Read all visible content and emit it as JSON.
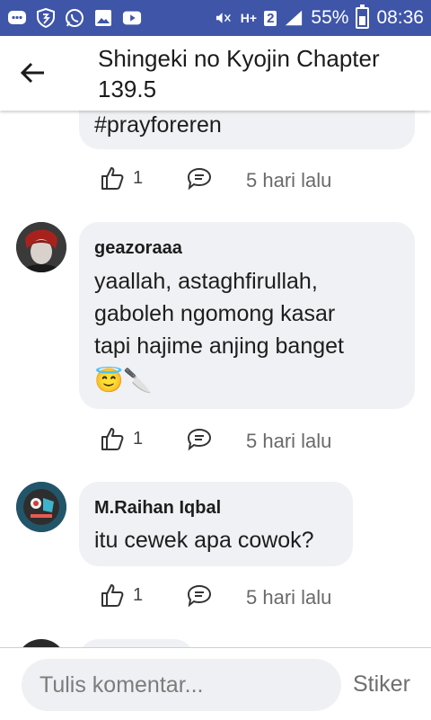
{
  "status_bar": {
    "battery": "55%",
    "time": "08:36",
    "network": "H+",
    "sim": "2",
    "icons": [
      "messenger-icon",
      "shield-icon",
      "whatsapp-icon",
      "gallery-icon",
      "youtube-icon",
      "mute-icon",
      "signal-icon",
      "battery-icon"
    ]
  },
  "header": {
    "title": "Shingeki no Kyojin Chapter 139.5"
  },
  "comments": [
    {
      "text": "#prayforeren",
      "likes": "1",
      "time": "5 hari lalu"
    },
    {
      "author": "geazoraaa",
      "text_lines": [
        "yaallah, astaghfirullah,",
        "gaboleh ngomong kasar",
        "tapi hajime anjing banget"
      ],
      "emoji": "😇🔪",
      "likes": "1",
      "time": "5 hari lalu"
    },
    {
      "author": "M.Raihan Iqbal",
      "text": "itu cewek apa cowok?",
      "likes": "1",
      "time": "5 hari lalu"
    }
  ],
  "composer": {
    "placeholder": "Tulis komentar...",
    "sticker_label": "Stiker"
  },
  "colors": {
    "status_bar": "#3e55a8",
    "bubble": "#f0f1f4",
    "text": "#1d1d1d",
    "muted": "#6a6a6a"
  }
}
